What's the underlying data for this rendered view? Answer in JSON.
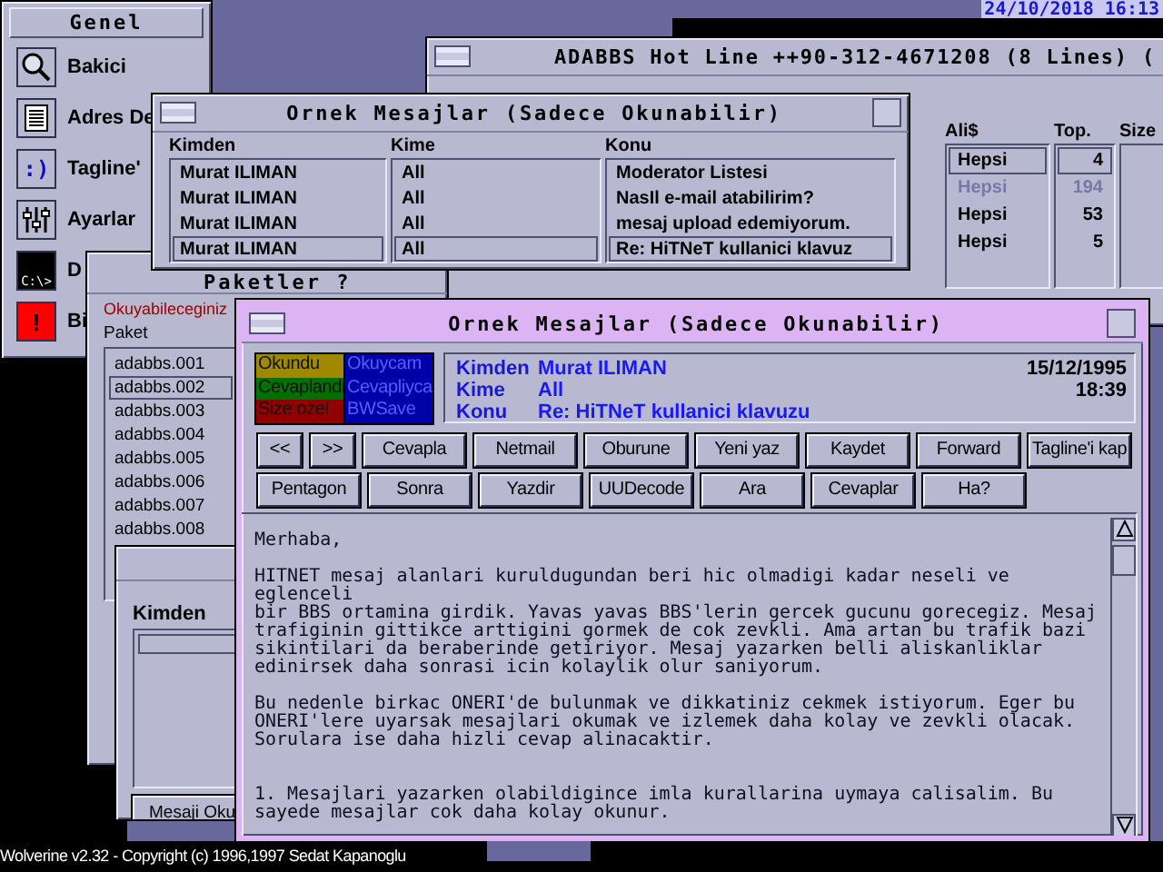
{
  "clock": "24/10/2018 16:13",
  "genel": {
    "title": "Genel",
    "items": [
      {
        "label": "Bakici",
        "kind": "search"
      },
      {
        "label": "Adres De",
        "kind": "list"
      },
      {
        "label": "Tagline'",
        "kind": "glyph",
        "glyph": ":)"
      },
      {
        "label": "Ayarlar",
        "kind": "sliders"
      },
      {
        "label": "D",
        "kind": "terminal",
        "glyph": "C:\\>"
      },
      {
        "label": "Bi",
        "kind": "alert",
        "glyph": "!"
      }
    ]
  },
  "hotline": {
    "title": "ADABBS Hot Line ++90-312-4671208 (8 Lines) (",
    "columns": [
      "Ali$",
      "Top.",
      "Size"
    ],
    "rows": [
      {
        "area": "Hepsi",
        "total": "4",
        "selected": true,
        "disabled": false
      },
      {
        "area": "Hepsi",
        "total": "194",
        "selected": false,
        "disabled": true
      },
      {
        "area": "Hepsi",
        "total": "53",
        "selected": false,
        "disabled": false
      },
      {
        "area": "Hepsi",
        "total": "5",
        "selected": false,
        "disabled": false
      }
    ]
  },
  "message_list": {
    "title": "Ornek Mesajlar (Sadece Okunabilir)",
    "columns": [
      "Kimden",
      "Kime",
      "Konu"
    ],
    "rows": [
      {
        "from": "Murat ILIMAN",
        "to": "All",
        "subject": "Moderator Listesi",
        "selected": false
      },
      {
        "from": "Murat ILIMAN",
        "to": "All",
        "subject": "NasIl e-mail atabilirim?",
        "selected": false
      },
      {
        "from": "Murat ILIMAN",
        "to": "All",
        "subject": "mesaj upload edemiyorum.",
        "selected": false
      },
      {
        "from": "Murat ILIMAN",
        "to": "All",
        "subject": "Re: HiTNeT kullanici klavuz",
        "selected": true
      }
    ]
  },
  "packets": {
    "title": "Paketler ?",
    "notice": "Okuyabileceginiz",
    "label": "Paket",
    "items": [
      {
        "name": "adabbs.001",
        "selected": false
      },
      {
        "name": "adabbs.002",
        "selected": true
      },
      {
        "name": "adabbs.003",
        "selected": false
      },
      {
        "name": "adabbs.004",
        "selected": false
      },
      {
        "name": "adabbs.005",
        "selected": false
      },
      {
        "name": "adabbs.006",
        "selected": false
      },
      {
        "name": "adabbs.007",
        "selected": false
      },
      {
        "name": "adabbs.008",
        "selected": false
      }
    ]
  },
  "search_dialog": {
    "label": "Kimden",
    "button": "Mesaji Oku"
  },
  "message": {
    "title": "Ornek Mesajlar (Sadece Okunabilir)",
    "legend": [
      {
        "label": "Okundu",
        "color": "#a08800"
      },
      {
        "label": "Okuycam",
        "color": "#0000a8"
      },
      {
        "label": "Cevaplandi",
        "color": "#007000"
      },
      {
        "label": "Cevapliyca",
        "color": "#0000a8"
      },
      {
        "label": "Size ozel",
        "color": "#900000"
      },
      {
        "label": "BWSave",
        "color": "#0000a8"
      }
    ],
    "header": [
      {
        "label": "Kimden",
        "value": "Murat ILIMAN",
        "extra": "15/12/1995"
      },
      {
        "label": "Kime",
        "value": "All",
        "extra": "18:39"
      },
      {
        "label": "Konu",
        "value": "Re: HiTNeT kullanici klavuzu"
      }
    ],
    "buttons": [
      [
        "<<",
        ">>",
        "Cevapla",
        "Netmail",
        "Oburune",
        "Yeni yaz",
        "Kaydet",
        "Forward",
        "Tagline'i kap"
      ],
      [
        "Pentagon",
        "Sonra",
        "Yazdir",
        "UUDecode",
        "Ara",
        "Cevaplar",
        "Ha?"
      ]
    ],
    "paragraphs": [
      [
        "Merhaba,"
      ],
      [
        "HITNET mesaj alanlari kuruldugundan beri hic olmadigi kadar neseli ve",
        "eglenceli",
        "bir BBS ortamina girdik. Yavas yavas BBS'lerin gercek gucunu gorecegiz. Mesaj",
        "trafiginin gittikce arttigini gormek de cok zevkli. Ama artan bu trafik bazi",
        "sikintilari da beraberinde getiriyor. Mesaj yazarken belli aliskanliklar",
        "edinirsek daha sonrasi icin kolaylik olur saniyorum."
      ],
      [
        "Bu nedenle birkac ONERI'de bulunmak ve dikkatiniz cekmek istiyorum. Eger bu",
        "ONERI'lere uyarsak mesajlari okumak ve izlemek daha kolay ve zevkli olacak.",
        "Sorulara ise daha hizli cevap alinacaktir."
      ],
      [
        "1. Mesajlari yazarken olabildigince imla kurallarina uymaya calisalim. Bu",
        "sayede mesajlar cok daha kolay okunur."
      ]
    ]
  },
  "status_bar": "Wolverine v2.32 - Copyright (c) 1996,1997 Sedat Kapanoglu"
}
